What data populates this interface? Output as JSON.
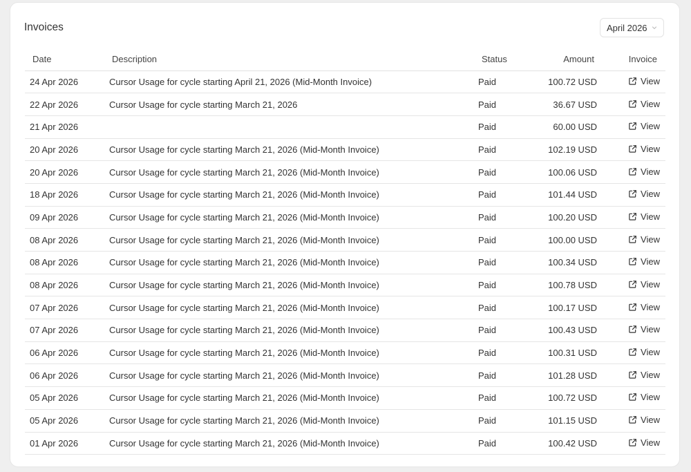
{
  "card": {
    "title": "Invoices",
    "month_select": {
      "value": "April 2026",
      "chevron_icon": "chevron-down-icon"
    }
  },
  "table": {
    "headers": {
      "date": "Date",
      "description": "Description",
      "status": "Status",
      "amount": "Amount",
      "invoice": "Invoice"
    },
    "view_label": "View",
    "view_icon": "external-link-icon",
    "rows": [
      {
        "date": "24 Apr 2026",
        "description": "Cursor Usage for cycle starting April 21, 2026 (Mid-Month Invoice)",
        "status": "Paid",
        "amount": "100.72 USD"
      },
      {
        "date": "22 Apr 2026",
        "description": "Cursor Usage for cycle starting March 21, 2026",
        "status": "Paid",
        "amount": "36.67 USD"
      },
      {
        "date": "21 Apr 2026",
        "description": "",
        "status": "Paid",
        "amount": "60.00 USD"
      },
      {
        "date": "20 Apr 2026",
        "description": "Cursor Usage for cycle starting March 21, 2026 (Mid-Month Invoice)",
        "status": "Paid",
        "amount": "102.19 USD"
      },
      {
        "date": "20 Apr 2026",
        "description": "Cursor Usage for cycle starting March 21, 2026 (Mid-Month Invoice)",
        "status": "Paid",
        "amount": "100.06 USD"
      },
      {
        "date": "18 Apr 2026",
        "description": "Cursor Usage for cycle starting March 21, 2026 (Mid-Month Invoice)",
        "status": "Paid",
        "amount": "101.44 USD"
      },
      {
        "date": "09 Apr 2026",
        "description": "Cursor Usage for cycle starting March 21, 2026 (Mid-Month Invoice)",
        "status": "Paid",
        "amount": "100.20 USD"
      },
      {
        "date": "08 Apr 2026",
        "description": "Cursor Usage for cycle starting March 21, 2026 (Mid-Month Invoice)",
        "status": "Paid",
        "amount": "100.00 USD"
      },
      {
        "date": "08 Apr 2026",
        "description": "Cursor Usage for cycle starting March 21, 2026 (Mid-Month Invoice)",
        "status": "Paid",
        "amount": "100.34 USD"
      },
      {
        "date": "08 Apr 2026",
        "description": "Cursor Usage for cycle starting March 21, 2026 (Mid-Month Invoice)",
        "status": "Paid",
        "amount": "100.78 USD"
      },
      {
        "date": "07 Apr 2026",
        "description": "Cursor Usage for cycle starting March 21, 2026 (Mid-Month Invoice)",
        "status": "Paid",
        "amount": "100.17 USD"
      },
      {
        "date": "07 Apr 2026",
        "description": "Cursor Usage for cycle starting March 21, 2026 (Mid-Month Invoice)",
        "status": "Paid",
        "amount": "100.43 USD"
      },
      {
        "date": "06 Apr 2026",
        "description": "Cursor Usage for cycle starting March 21, 2026 (Mid-Month Invoice)",
        "status": "Paid",
        "amount": "100.31 USD"
      },
      {
        "date": "06 Apr 2026",
        "description": "Cursor Usage for cycle starting March 21, 2026 (Mid-Month Invoice)",
        "status": "Paid",
        "amount": "101.28 USD"
      },
      {
        "date": "05 Apr 2026",
        "description": "Cursor Usage for cycle starting March 21, 2026 (Mid-Month Invoice)",
        "status": "Paid",
        "amount": "100.72 USD"
      },
      {
        "date": "05 Apr 2026",
        "description": "Cursor Usage for cycle starting March 21, 2026 (Mid-Month Invoice)",
        "status": "Paid",
        "amount": "101.15 USD"
      },
      {
        "date": "01 Apr 2026",
        "description": "Cursor Usage for cycle starting March 21, 2026 (Mid-Month Invoice)",
        "status": "Paid",
        "amount": "100.42 USD"
      }
    ]
  }
}
